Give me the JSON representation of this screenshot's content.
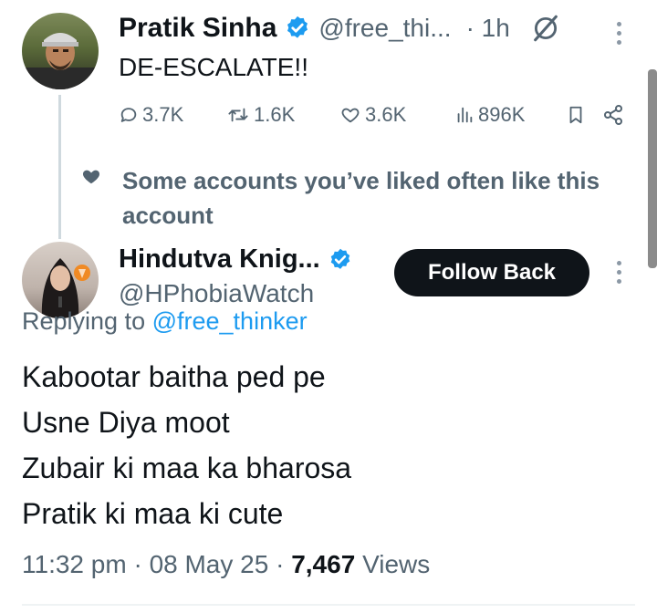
{
  "tweet1": {
    "name": "Pratik Sinha",
    "handle": "@free_thi...",
    "time": "· 1h",
    "text": "DE-ESCALATE!!",
    "replies": "3.7K",
    "reposts": "1.6K",
    "likes": "3.6K",
    "views": "896K"
  },
  "social_context": {
    "text": "Some accounts you’ve liked often like this account"
  },
  "tweet2": {
    "name": "Hindutva Knig...",
    "handle": "@HPhobiaWatch",
    "follow_label": "Follow Back",
    "replying_prefix": "Replying to",
    "replying_handle": "@free_thinker",
    "lines": [
      "Kabootar baitha ped pe",
      "Usne Diya moot",
      "Zubair ki maa ka bharosa",
      "Pratik ki maa ki cute"
    ],
    "time": "11:32 pm",
    "date": "08 May 25",
    "views_count": "7,467",
    "views_label": "Views"
  },
  "colors": {
    "text": "#0f1419",
    "muted": "#536471",
    "link": "#1d9bf0",
    "verified": "#1d9bf0",
    "button_bg": "#0f1419"
  }
}
